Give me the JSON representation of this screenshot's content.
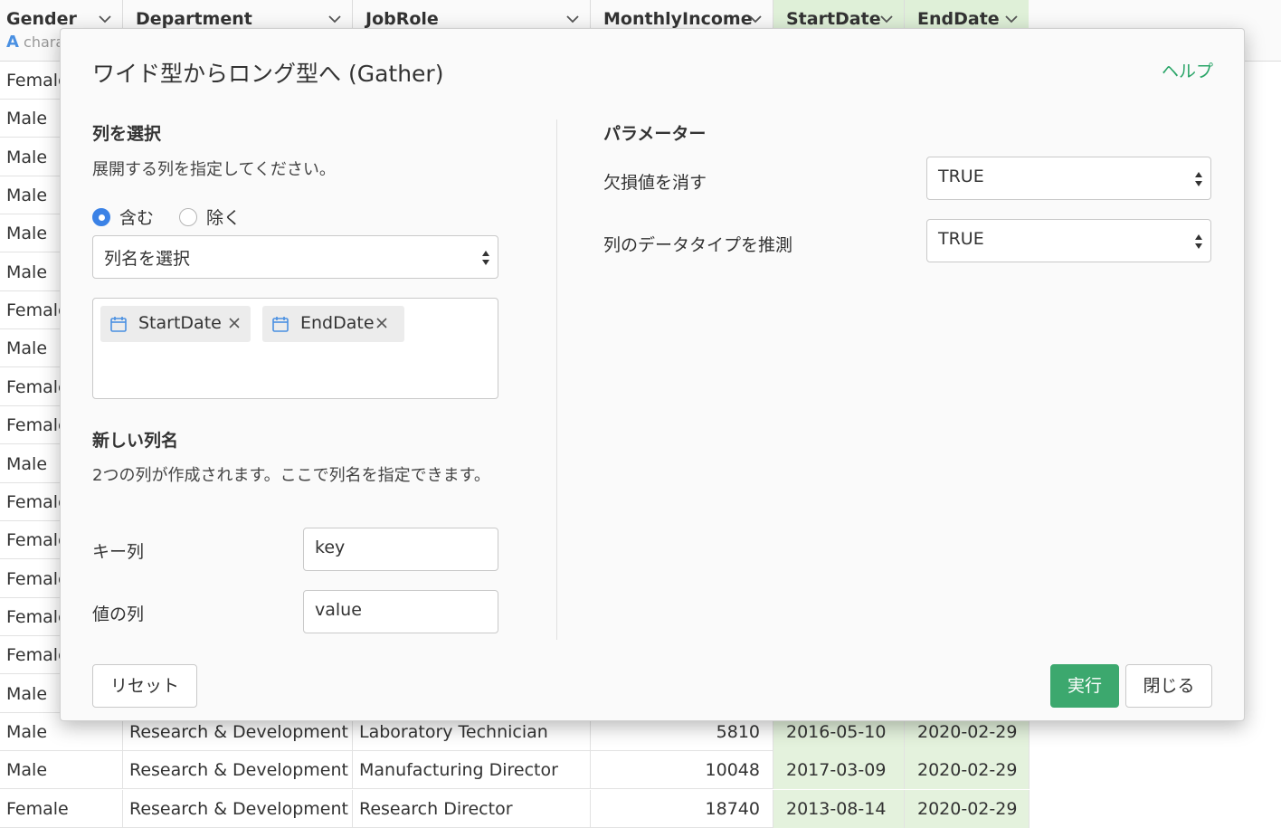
{
  "grid": {
    "columns": [
      {
        "name": "Gender",
        "type_label": "chara"
      },
      {
        "name": "Department"
      },
      {
        "name": "JobRole"
      },
      {
        "name": "MonthlyIncome"
      },
      {
        "name": "StartDate"
      },
      {
        "name": "EndDate"
      }
    ],
    "gender_rows": [
      "Female",
      "Male",
      "Male",
      "Male",
      "Male",
      "Male",
      "Female",
      "Male",
      "Female",
      "Female",
      "Male",
      "Female",
      "Female",
      "Female",
      "Female",
      "Female",
      "Male"
    ],
    "full_rows": [
      {
        "gender": "Male",
        "department": "Research & Development",
        "jobrole": "Laboratory Technician",
        "income": "5810",
        "start": "2016-05-10",
        "end": "2020-02-29"
      },
      {
        "gender": "Male",
        "department": "Research & Development",
        "jobrole": "Manufacturing Director",
        "income": "10048",
        "start": "2017-03-09",
        "end": "2020-02-29"
      },
      {
        "gender": "Female",
        "department": "Research & Development",
        "jobrole": "Research Director",
        "income": "18740",
        "start": "2013-08-14",
        "end": "2020-02-29"
      }
    ]
  },
  "dialog": {
    "title": "ワイド型からロング型へ (Gather)",
    "help": "ヘルプ",
    "select_section": {
      "title": "列を選択",
      "description": "展開する列を指定してください。",
      "radio_include": "含む",
      "radio_exclude": "除く",
      "column_select_placeholder": "列名を選択",
      "selected_columns": [
        "StartDate",
        "EndDate"
      ]
    },
    "new_names_section": {
      "title": "新しい列名",
      "description": "2つの列が作成されます。ここで列名を指定できます。",
      "key_label": "キー列",
      "key_value": "key",
      "value_label": "値の列",
      "value_value": "value"
    },
    "params_section": {
      "title": "パラメーター",
      "remove_na_label": "欠損値を消す",
      "remove_na_value": "TRUE",
      "convert_label": "列のデータタイプを推測",
      "convert_value": "TRUE"
    },
    "buttons": {
      "reset": "リセット",
      "run": "実行",
      "close": "閉じる"
    }
  },
  "colors": {
    "accent_green": "#3ca86e",
    "help_green": "#2aa568",
    "date_column_bg": "#dff0d8",
    "radio_blue": "#3b82e6",
    "calendar_icon": "#4a90e2"
  }
}
